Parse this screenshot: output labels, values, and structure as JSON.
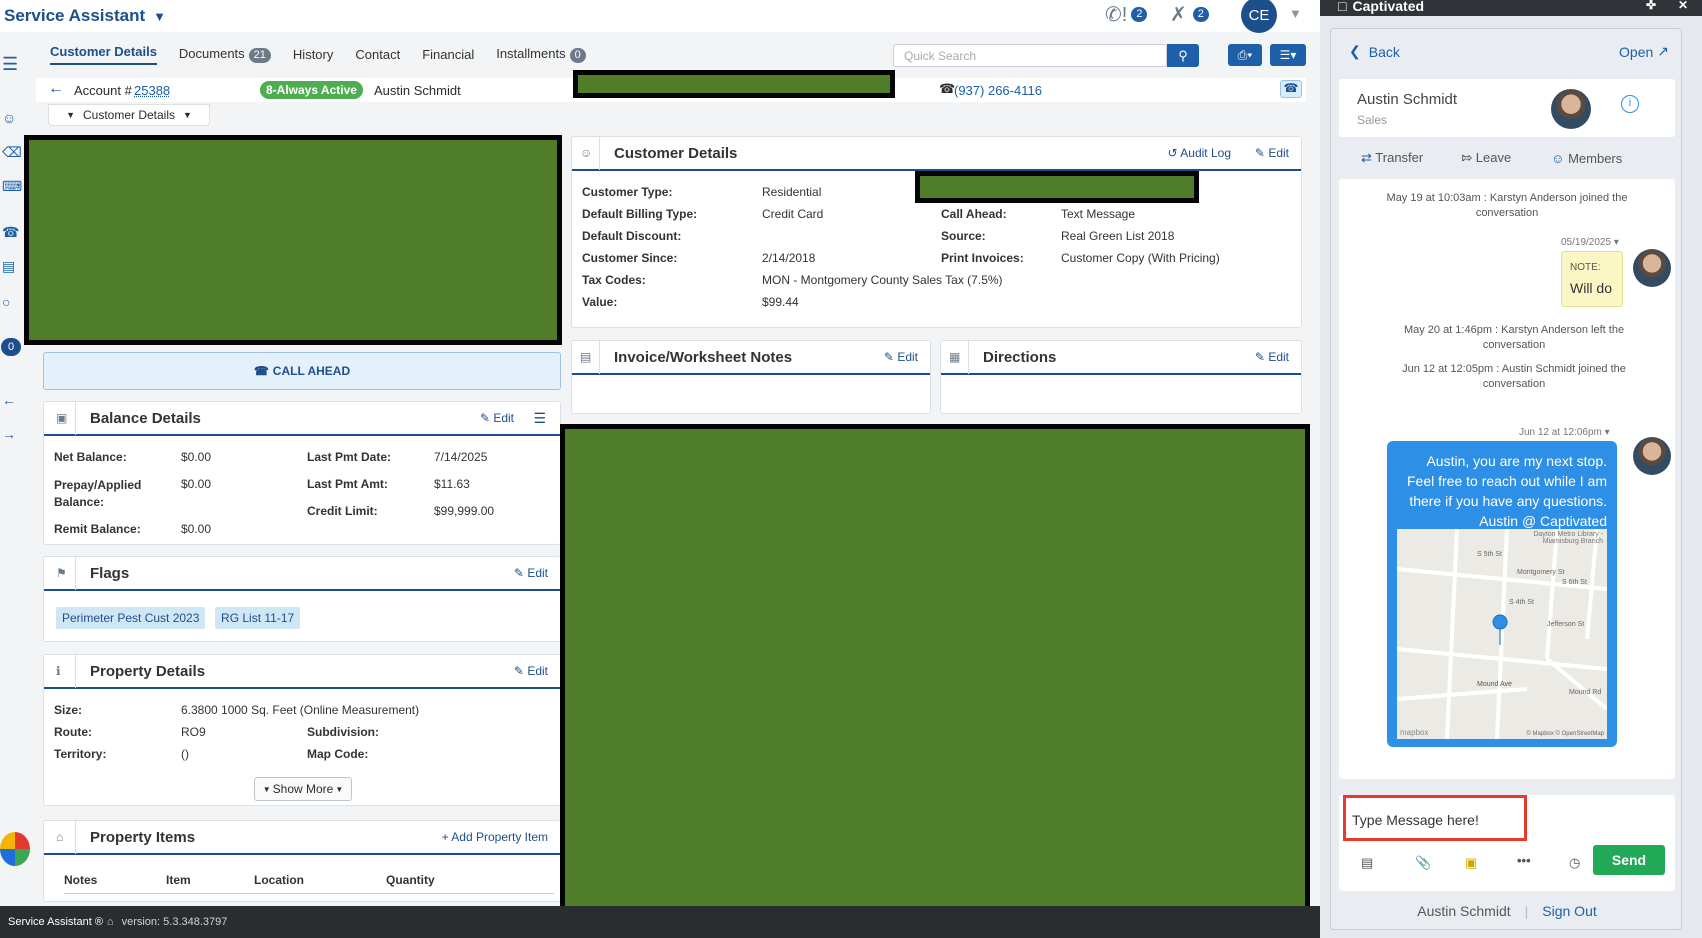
{
  "app": {
    "title": "Service Assistant"
  },
  "top": {
    "calls_count": "2",
    "tools_count": "2",
    "user_initials": "CE"
  },
  "tabs": [
    {
      "label": "Customer Details"
    },
    {
      "label": "Documents",
      "badge": "21"
    },
    {
      "label": "History"
    },
    {
      "label": "Contact"
    },
    {
      "label": "Financial"
    },
    {
      "label": "Installments",
      "badge": "0"
    }
  ],
  "search": {
    "placeholder": "Quick Search"
  },
  "account": {
    "label": "Account #",
    "number": "25388",
    "status": "8-Always Active",
    "name": "Austin Schmidt",
    "phone": "(937) 266-4116"
  },
  "section_dropdown": "Customer Details",
  "sidebar": {
    "badge": "0"
  },
  "call_ahead": "CALL AHEAD",
  "customer_details": {
    "title": "Customer Details",
    "audit_log": "Audit Log",
    "edit": "Edit",
    "left": [
      {
        "label": "Customer Type:",
        "value": "Residential"
      },
      {
        "label": "Default Billing Type:",
        "value": "Credit Card"
      },
      {
        "label": "Default Discount:",
        "value": ""
      },
      {
        "label": "Customer Since:",
        "value": "2/14/2018"
      },
      {
        "label": "Tax Codes:",
        "value": "MON - Montgomery County Sales Tax  (7.5%)"
      },
      {
        "label": "Value:",
        "value": "$99.44"
      }
    ],
    "right": [
      {
        "label": "Call Ahead:",
        "value": "Text Message"
      },
      {
        "label": "Source:",
        "value": "Real Green List 2018"
      },
      {
        "label": "Print Invoices:",
        "value": "Customer Copy (With Pricing)"
      }
    ]
  },
  "notes_panel": {
    "title": "Invoice/Worksheet Notes",
    "edit": "Edit"
  },
  "directions_panel": {
    "title": "Directions",
    "edit": "Edit"
  },
  "balance": {
    "title": "Balance Details",
    "edit": "Edit",
    "left": [
      {
        "label": "Net Balance:",
        "value": "$0.00"
      },
      {
        "label": "Prepay/Applied Balance:",
        "value": "$0.00"
      },
      {
        "label": "Remit Balance:",
        "value": "$0.00"
      }
    ],
    "right": [
      {
        "label": "Last Pmt Date:",
        "value": "7/14/2025"
      },
      {
        "label": "Last Pmt Amt:",
        "value": "$11.63"
      },
      {
        "label": "Credit Limit:",
        "value": "$99,999.00"
      }
    ]
  },
  "flags": {
    "title": "Flags",
    "edit": "Edit",
    "chips": [
      "Perimeter Pest Cust 2023",
      "RG List 11-17"
    ]
  },
  "property": {
    "title": "Property Details",
    "edit": "Edit",
    "size_label": "Size:",
    "size": "6.3800 1000 Sq. Feet (Online Measurement)",
    "route_label": "Route:",
    "route": "RO9",
    "subdivision_label": "Subdivision:",
    "territory_label": "Territory:",
    "territory": "()",
    "map_code_label": "Map Code:",
    "show_more": "Show More"
  },
  "property_items": {
    "title": "Property Items",
    "add": "Add Property Item",
    "columns": [
      "Notes",
      "Item",
      "Location",
      "Quantity"
    ]
  },
  "status_bar": {
    "brand": "Service Assistant ®",
    "version": "version: 5.3.348.3797"
  },
  "chat": {
    "app_name": "Captivated",
    "back": "Back",
    "open": "Open",
    "contact_name": "Austin Schmidt",
    "contact_role": "Sales",
    "actions": [
      "Transfer",
      "Leave",
      "Members"
    ],
    "events": [
      "May 19 at 10:03am : Karstyn Anderson joined the conversation",
      "May 20 at 1:46pm : Karstyn Anderson left the conversation",
      "Jun 12 at 12:05pm : Austin Schmidt joined the conversation"
    ],
    "note_date": "05/19/2025",
    "note_label": "NOTE:",
    "note_text": "Will do",
    "msg_date": "Jun 12 at 12:06pm",
    "msg_text": "Austin, you are my next stop. Feel free to reach out while I am there if you have any questions. Austin @ Captivated",
    "map": {
      "place": "Dayton Metro Library - Miamisburg Branch",
      "streets": [
        "S 5th St",
        "Montgomery St",
        "S 4th St",
        "S 6th St",
        "Jefferson St",
        "Mound Ave",
        "Mound Rd"
      ],
      "credit_left": "mapbox",
      "credit_right": "© Mapbox © OpenStreetMap"
    },
    "input_placeholder": "Type Message here!",
    "send": "Send",
    "footer_user": "Austin Schmidt",
    "sign_out": "Sign Out"
  }
}
